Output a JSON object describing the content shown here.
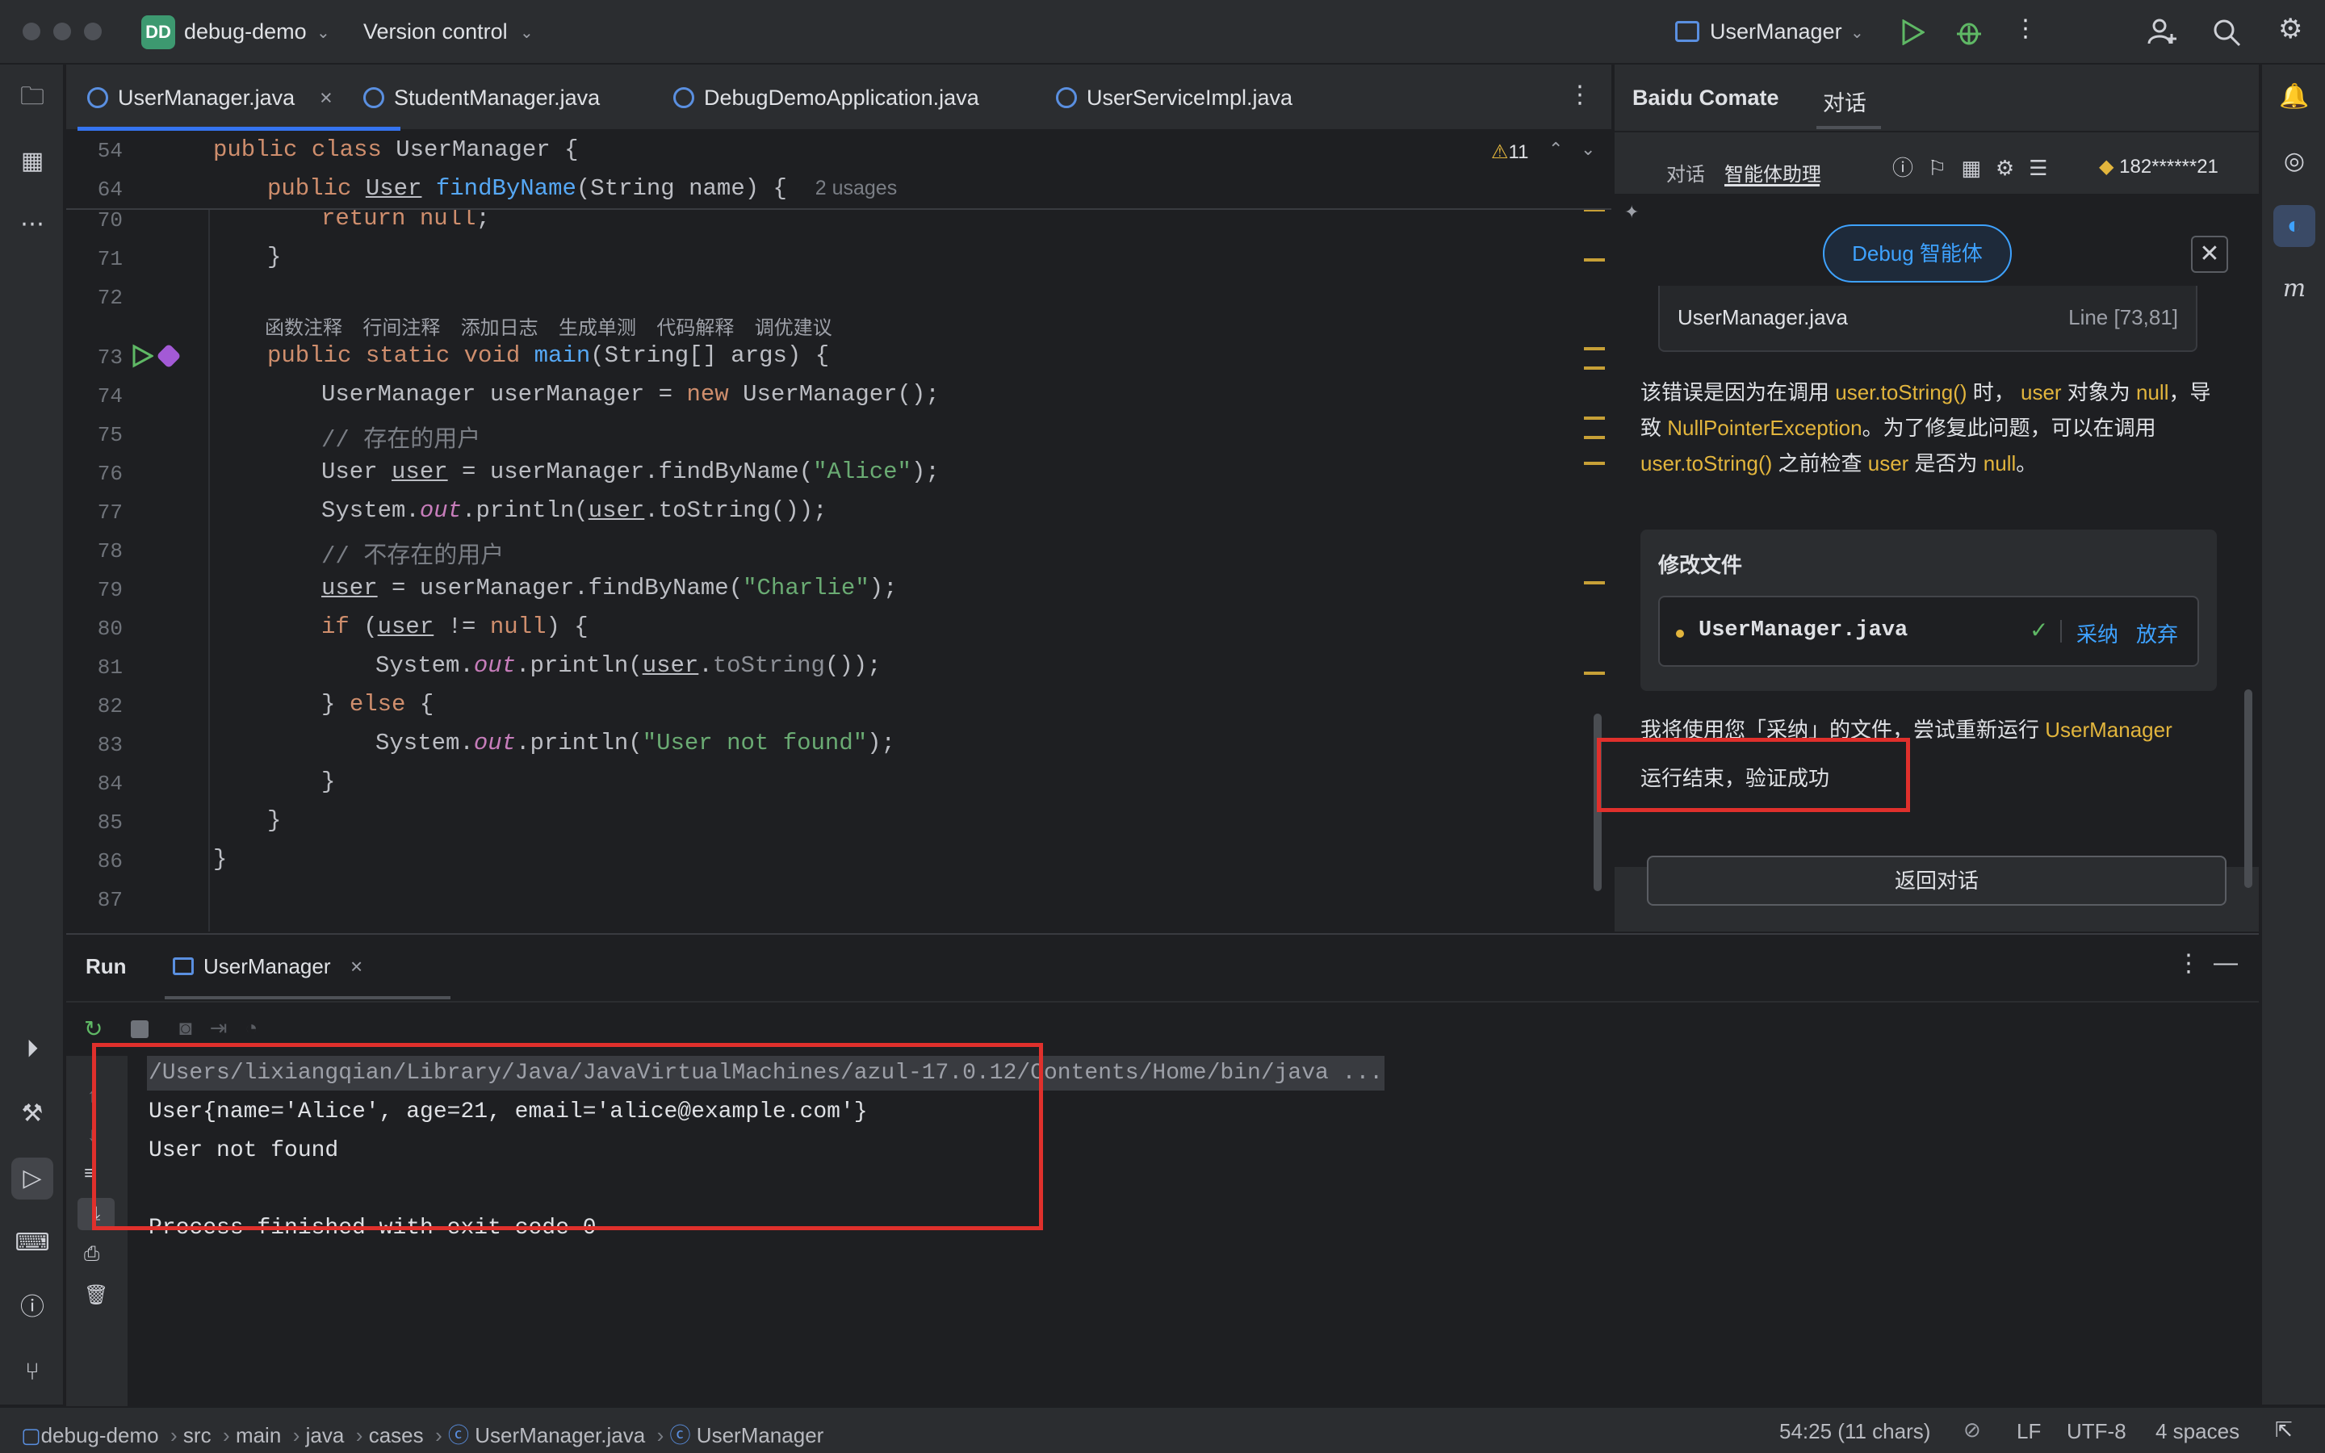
{
  "titlebar": {
    "project_badge": "DD",
    "project": "debug-demo",
    "vcs": "Version control",
    "run_config": "UserManager"
  },
  "tabs": [
    {
      "label": "UserManager.java"
    },
    {
      "label": "StudentManager.java"
    },
    {
      "label": "DebugDemoApplication.java"
    },
    {
      "label": "UserServiceImpl.java"
    }
  ],
  "editor": {
    "warnings": "11",
    "sticky": [
      {
        "num": "54",
        "code": "public class UserManager {"
      },
      {
        "num": "64",
        "code": "public User findByName(String name) {",
        "usages": "2 usages"
      }
    ],
    "lines": [
      {
        "num": "70",
        "code": "return null;"
      },
      {
        "num": "71",
        "code": "}"
      },
      {
        "num": "72",
        "code": ""
      },
      {
        "num": "73",
        "code": "public static void main(String[] args) {"
      },
      {
        "num": "74",
        "code": "UserManager userManager = new UserManager();"
      },
      {
        "num": "75",
        "code": "// 存在的用户"
      },
      {
        "num": "76",
        "code": "User user = userManager.findByName(\"Alice\");"
      },
      {
        "num": "77",
        "code": "System.out.println(user.toString());"
      },
      {
        "num": "78",
        "code": "// 不存在的用户"
      },
      {
        "num": "79",
        "code": "user = userManager.findByName(\"Charlie\");"
      },
      {
        "num": "80",
        "code": "if (user != null) {"
      },
      {
        "num": "81",
        "code": "System.out.println(user.toString());"
      },
      {
        "num": "82",
        "code": "} else {"
      },
      {
        "num": "83",
        "code": "System.out.println(\"User not found\");"
      },
      {
        "num": "84",
        "code": "}"
      },
      {
        "num": "85",
        "code": "}"
      },
      {
        "num": "86",
        "code": "}"
      },
      {
        "num": "87",
        "code": ""
      }
    ],
    "codelens": [
      "函数注释",
      "行间注释",
      "添加日志",
      "生成单测",
      "代码解释",
      "调优建议"
    ]
  },
  "panel": {
    "title": "Baidu Comate",
    "tab_chat": "对话",
    "sub_chat": "对话",
    "sub_agent": "智能体助理",
    "user": "182******21",
    "debug_button": "Debug 智能体",
    "file_ref": {
      "name": "UserManager.java",
      "line": "Line [73,81]"
    },
    "explain_parts": [
      "该错误是因为在调用 ",
      "user.toString()",
      " 时， ",
      "user",
      " 对象为 ",
      "null",
      "，导致 ",
      "NullPointerException",
      "。为了修复此问题，可以在调用 ",
      "user.toString()",
      " 之前检查 ",
      "user",
      " 是否为 ",
      "null",
      "。"
    ],
    "modify_title": "修改文件",
    "modify_file": "UserManager.java",
    "accept": "采纳",
    "discard": "放弃",
    "rerun_text": "我将使用您「采纳」的文件，尝试重新运行 ",
    "rerun_target": "UserManager",
    "result": "运行结束，验证成功",
    "back_button": "返回对话"
  },
  "run": {
    "title": "Run",
    "tab": "UserManager",
    "console": [
      "/Users/lixiangqian/Library/Java/JavaVirtualMachines/azul-17.0.12/Contents/Home/bin/java ...",
      "User{name='Alice', age=21, email='alice@example.com'}",
      "User not found",
      "",
      "Process finished with exit code 0"
    ]
  },
  "status": {
    "breadcrumb": [
      "debug-demo",
      "src",
      "main",
      "java",
      "cases",
      "UserManager.java",
      "UserManager"
    ],
    "position": "54:25 (11 chars)",
    "line_sep": "LF",
    "encoding": "UTF-8",
    "indent": "4 spaces"
  }
}
